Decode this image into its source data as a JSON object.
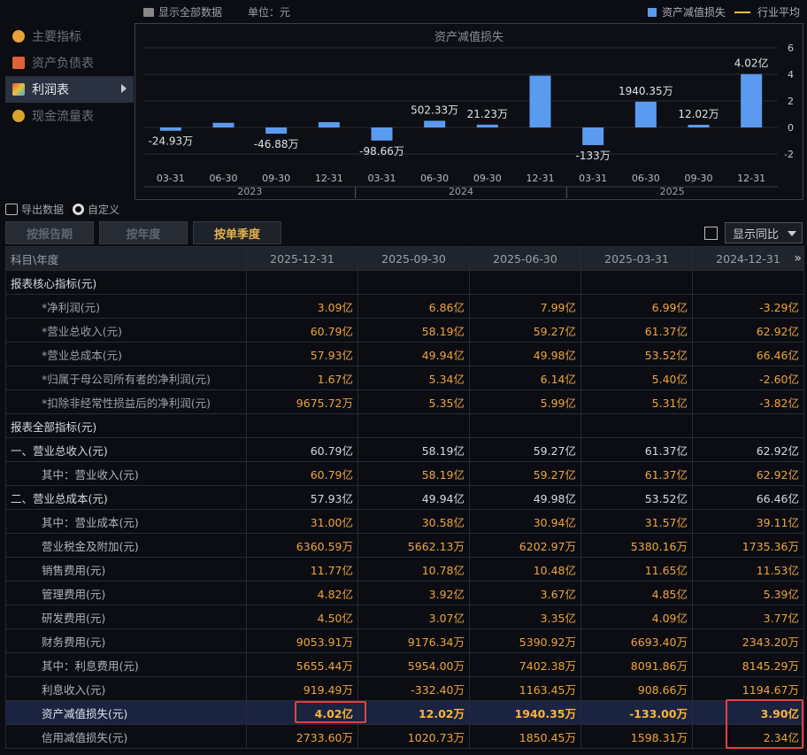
{
  "toolbar": {
    "show_all": "显示全部数据",
    "unit": "单位：元",
    "legend_bar": "资产减值损失",
    "legend_line": "行业平均"
  },
  "nav": {
    "items": [
      {
        "label": "主要指标",
        "icon": "asterisk-icon",
        "color": "#e8a23a"
      },
      {
        "label": "资产负债表",
        "icon": "sheet-icon",
        "color": "#e0603a"
      },
      {
        "label": "利润表",
        "icon": "cube-icon",
        "color": "#5aa858"
      },
      {
        "label": "现金流量表",
        "icon": "coins-icon",
        "color": "#d8a32a"
      }
    ]
  },
  "chart_data": {
    "type": "bar",
    "title": "资产减值损失",
    "categories": [
      "2023-03-31",
      "2023-06-30",
      "2023-09-30",
      "2023-12-31",
      "2024-03-31",
      "2024-06-30",
      "2024-09-30",
      "2024-12-31",
      "2025-03-31",
      "2025-06-30",
      "2025-09-30",
      "2025-12-31"
    ],
    "tick_labels": [
      "03-31",
      "06-30",
      "09-30",
      "12-31",
      "03-31",
      "06-30",
      "09-30",
      "12-31",
      "03-31",
      "06-30",
      "09-30",
      "12-31"
    ],
    "year_labels": [
      "2023",
      "2024",
      "2025"
    ],
    "values": [
      -0.2493,
      0.35,
      -0.4688,
      0.4,
      -0.9866,
      0.5023,
      0.2123,
      3.9,
      -1.33,
      1.9404,
      0.1202,
      4.02
    ],
    "data_labels": [
      "-24.93万",
      "",
      "-46.88万",
      "",
      "-98.66万",
      "502.33万",
      "21.23万",
      "",
      "-133万",
      "1940.35万",
      "12.02万",
      "4.02亿"
    ],
    "yticks": [
      6,
      4,
      2,
      0,
      -2
    ],
    "ylim": [
      -3,
      6
    ],
    "bar_color": "#5b9bef"
  },
  "tools": {
    "export": "导出数据",
    "custom": "自定义"
  },
  "tabs": [
    "按报告期",
    "按年度",
    "按单季度"
  ],
  "yoy": {
    "label": "显示同比"
  },
  "table": {
    "header": [
      "科目\\年度",
      "2025-12-31",
      "2025-09-30",
      "2025-06-30",
      "2025-03-31",
      "2024-12-31"
    ],
    "rows": [
      {
        "label": "报表核心指标(元)",
        "kind": "section",
        "values": [
          "",
          "",
          "",
          "",
          ""
        ]
      },
      {
        "label": "*净利润(元)",
        "kind": "ind1",
        "values": [
          "3.09亿",
          "6.86亿",
          "7.99亿",
          "6.99亿",
          "-3.29亿"
        ]
      },
      {
        "label": "*营业总收入(元)",
        "kind": "ind1",
        "values": [
          "60.79亿",
          "58.19亿",
          "59.27亿",
          "61.37亿",
          "62.92亿"
        ]
      },
      {
        "label": "*营业总成本(元)",
        "kind": "ind1",
        "values": [
          "57.93亿",
          "49.94亿",
          "49.98亿",
          "53.52亿",
          "66.46亿"
        ]
      },
      {
        "label": "*归属于母公司所有者的净利润(元)",
        "kind": "ind1",
        "values": [
          "1.67亿",
          "5.34亿",
          "6.14亿",
          "5.40亿",
          "-2.60亿"
        ]
      },
      {
        "label": "*扣除非经常性损益后的净利润(元)",
        "kind": "ind1",
        "values": [
          "9675.72万",
          "5.35亿",
          "5.99亿",
          "5.31亿",
          "-3.82亿"
        ]
      },
      {
        "label": "报表全部指标(元)",
        "kind": "section",
        "values": [
          "",
          "",
          "",
          "",
          ""
        ]
      },
      {
        "label": "一、营业总收入(元)",
        "kind": "section",
        "values": [
          "60.79亿",
          "58.19亿",
          "59.27亿",
          "61.37亿",
          "62.92亿"
        ]
      },
      {
        "label": "其中：营业收入(元)",
        "kind": "ind2",
        "values": [
          "60.79亿",
          "58.19亿",
          "59.27亿",
          "61.37亿",
          "62.92亿"
        ]
      },
      {
        "label": "二、营业总成本(元)",
        "kind": "section",
        "values": [
          "57.93亿",
          "49.94亿",
          "49.98亿",
          "53.52亿",
          "66.46亿"
        ]
      },
      {
        "label": "其中：营业成本(元)",
        "kind": "ind2",
        "values": [
          "31.00亿",
          "30.58亿",
          "30.94亿",
          "31.57亿",
          "39.11亿"
        ]
      },
      {
        "label": "营业税金及附加(元)",
        "kind": "ind2",
        "values": [
          "6360.59万",
          "5662.13万",
          "6202.97万",
          "5380.16万",
          "1735.36万"
        ]
      },
      {
        "label": "销售费用(元)",
        "kind": "ind2",
        "values": [
          "11.77亿",
          "10.78亿",
          "10.48亿",
          "11.65亿",
          "11.53亿"
        ]
      },
      {
        "label": "管理费用(元)",
        "kind": "ind2",
        "values": [
          "4.82亿",
          "3.92亿",
          "3.67亿",
          "4.85亿",
          "5.39亿"
        ]
      },
      {
        "label": "研发费用(元)",
        "kind": "ind2",
        "values": [
          "4.50亿",
          "3.07亿",
          "3.35亿",
          "4.09亿",
          "3.77亿"
        ]
      },
      {
        "label": "财务费用(元)",
        "kind": "ind2",
        "values": [
          "9053.91万",
          "9176.34万",
          "5390.92万",
          "6693.40万",
          "2343.20万"
        ]
      },
      {
        "label": "其中：利息费用(元)",
        "kind": "ind2",
        "values": [
          "5655.44万",
          "5954.00万",
          "7402.38万",
          "8091.86万",
          "8145.29万"
        ]
      },
      {
        "label": "利息收入(元)",
        "kind": "ind2",
        "values": [
          "919.49万",
          "-332.40万",
          "1163.45万",
          "908.66万",
          "1194.67万"
        ]
      },
      {
        "label": "资产减值损失(元)",
        "kind": "hl",
        "values": [
          "4.02亿",
          "12.02万",
          "1940.35万",
          "-133.00万",
          "3.90亿"
        ]
      },
      {
        "label": "信用减值损失(元)",
        "kind": "ind2",
        "values": [
          "2733.60万",
          "1020.73万",
          "1850.45万",
          "1598.31万",
          "2.34亿"
        ]
      }
    ]
  }
}
